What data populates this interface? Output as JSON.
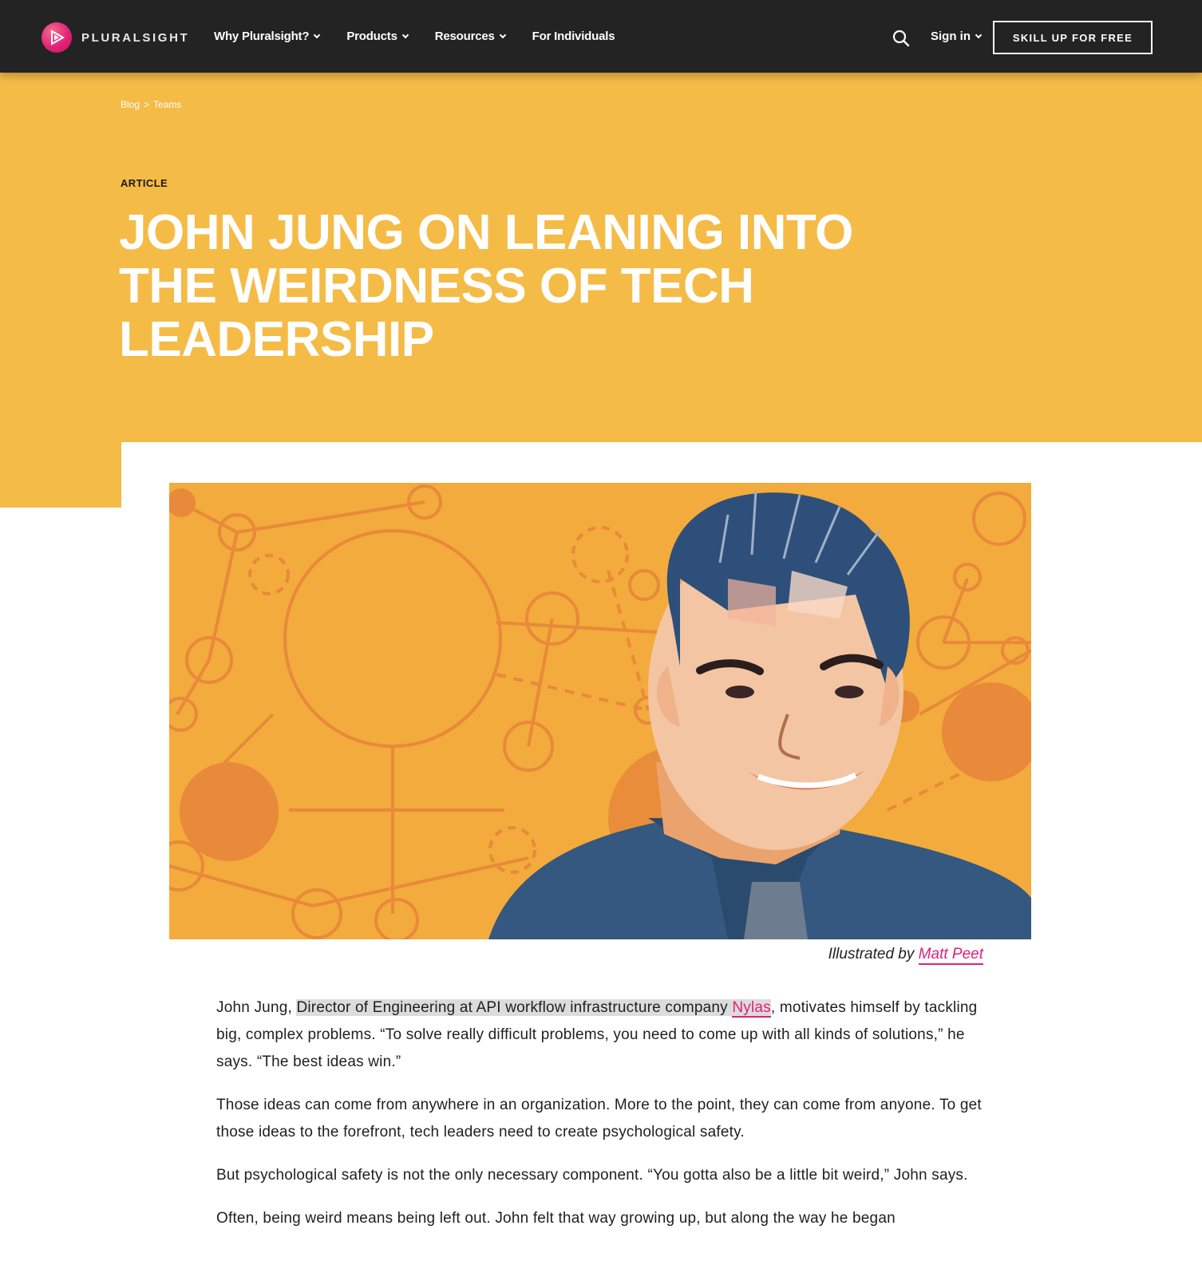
{
  "nav": {
    "brand": "PLURALSIGHT",
    "items": [
      {
        "label": "Why Pluralsight?",
        "dropdown": true
      },
      {
        "label": "Products",
        "dropdown": true
      },
      {
        "label": "Resources",
        "dropdown": true
      },
      {
        "label": "For Individuals",
        "dropdown": false
      }
    ],
    "sign_in": "Sign in",
    "cta": "SKILL UP FOR FREE"
  },
  "hero": {
    "breadcrumb": {
      "blog": "Blog",
      "sep": ">",
      "section": "Teams"
    },
    "eyebrow": "ARTICLE",
    "title": "JOHN JUNG ON LEANING INTO THE WEIRDNESS OF TECH LEADERSHIP"
  },
  "illustration": {
    "caption_prefix": "Illustrated by",
    "caption_author": "Matt Peet"
  },
  "article": {
    "p1": {
      "lead": "John Jung, ",
      "highlight": "Director of Engineering at API workflow infrastructure company ",
      "link": "Nylas",
      "rest": ", motivates himself by tackling big, complex problems. “To solve really difficult problems, you need to come up with all kinds of solutions,” he says. “The best ideas win.”"
    },
    "p2": "Those ideas can come from anywhere in an organization. More to the point, they can come from anyone. To get those ideas to the forefront, tech leaders need to create psychological safety.",
    "p3": "But psychological safety is not the only necessary component. “You gotta also be a little bit weird,” John says.",
    "p4": "Often, being weird means being left out. John felt that way growing up, but along the way he began"
  },
  "colors": {
    "nav_bg": "#232323",
    "hero_bg": "#f5bb47",
    "accent_link": "#e0207d",
    "logo_pink": "#e2227a"
  }
}
